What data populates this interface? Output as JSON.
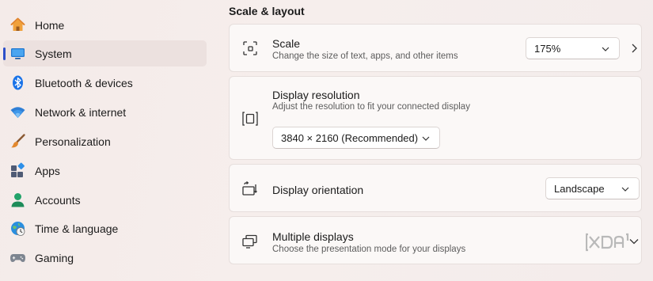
{
  "sidebar": {
    "items": [
      {
        "label": "Home",
        "icon": "home-icon"
      },
      {
        "label": "System",
        "icon": "system-icon",
        "selected": true
      },
      {
        "label": "Bluetooth & devices",
        "icon": "bluetooth-icon"
      },
      {
        "label": "Network & internet",
        "icon": "wifi-icon"
      },
      {
        "label": "Personalization",
        "icon": "brush-icon"
      },
      {
        "label": "Apps",
        "icon": "apps-icon"
      },
      {
        "label": "Accounts",
        "icon": "accounts-icon"
      },
      {
        "label": "Time & language",
        "icon": "clock-globe-icon"
      },
      {
        "label": "Gaming",
        "icon": "gamepad-icon"
      }
    ]
  },
  "main": {
    "section_title": "Scale & layout",
    "scale": {
      "title": "Scale",
      "description": "Change the size of text, apps, and other items",
      "value": "175%"
    },
    "resolution": {
      "title": "Display resolution",
      "description": "Adjust the resolution to fit your connected display",
      "value": "3840 × 2160 (Recommended)"
    },
    "orientation": {
      "title": "Display orientation",
      "value": "Landscape"
    },
    "multiple_displays": {
      "title": "Multiple displays",
      "description": "Choose the presentation mode for your displays"
    }
  },
  "watermark": {
    "text": "XDA"
  },
  "colors": {
    "accent": "#2c4fc9",
    "background": "#f4ebe9",
    "card": "#fbf8f7"
  }
}
